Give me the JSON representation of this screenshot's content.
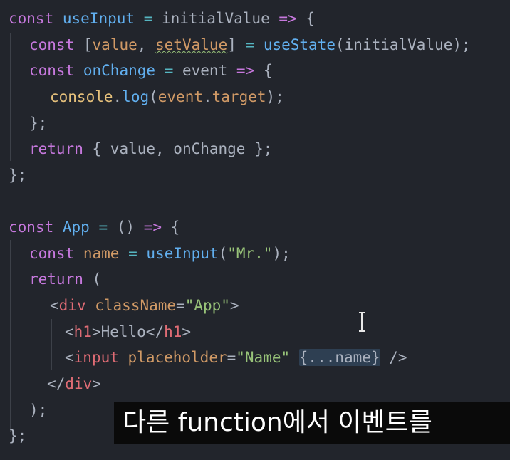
{
  "code": {
    "line1": [
      "const",
      "useInput",
      "=",
      "initialValue",
      "=>",
      "{"
    ],
    "line2": [
      "const",
      "[",
      "value",
      ",",
      "setValue",
      "]",
      "=",
      "useState",
      "(",
      "initialValue",
      ");"
    ],
    "line3": [
      "const",
      "onChange",
      "=",
      "event",
      "=>",
      "{"
    ],
    "line4": [
      "console",
      ".",
      "log",
      "(",
      "event",
      ".",
      "target",
      ");"
    ],
    "line5": [
      "};"
    ],
    "line6": [
      "return",
      "{ value, onChange };"
    ],
    "line7": [
      "};"
    ],
    "line9": [
      "const",
      "App",
      "=",
      "()",
      "=>",
      "{"
    ],
    "line10": [
      "const",
      "name",
      "=",
      "useInput",
      "(",
      "\"Mr.\"",
      ");"
    ],
    "line11": [
      "return",
      "("
    ],
    "line12": [
      "<",
      "div",
      "className",
      "=",
      "\"App\"",
      ">"
    ],
    "line13": [
      "<",
      "h1",
      ">Hello</",
      "h1",
      ">"
    ],
    "line14": [
      "<",
      "input",
      "placeholder",
      "=",
      "\"Name\"",
      "{...name}",
      "/>"
    ],
    "line15": [
      "</",
      "div",
      ">"
    ],
    "line16": [
      ");"
    ],
    "line17": [
      "};"
    ]
  },
  "cursor_icon": "text-cursor-icon",
  "subtitle": "다른 function에서 이벤트를"
}
